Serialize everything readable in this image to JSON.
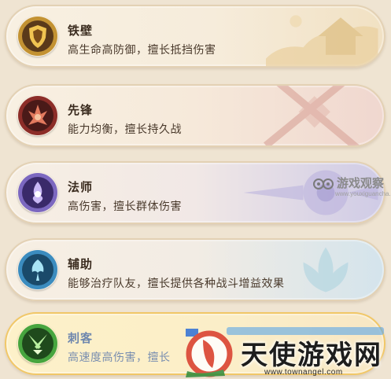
{
  "roles": [
    {
      "name": "铁壁",
      "desc": "高生命高防御，擅长抵挡伤害",
      "icon": "shield-icon",
      "color": "#b8872a"
    },
    {
      "name": "先锋",
      "desc": "能力均衡，擅长持久战",
      "icon": "vanguard-icon",
      "color": "#a83a34"
    },
    {
      "name": "法师",
      "desc": "高伤害，擅长群体伤害",
      "icon": "mage-icon",
      "color": "#6c56b0"
    },
    {
      "name": "辅助",
      "desc": "能够治疗队友，擅长提供各种战斗增益效果",
      "icon": "support-icon",
      "color": "#3f8fb8"
    },
    {
      "name": "刺客",
      "desc": "高速度高伤害，擅长",
      "icon": "assassin-icon",
      "color": "#3e9a3a"
    }
  ],
  "watermark": {
    "text": "游戏观察",
    "sub": "www.youxiguancha.com"
  },
  "logo": {
    "text": "天使游戏网",
    "url": "www.townangel.com"
  }
}
